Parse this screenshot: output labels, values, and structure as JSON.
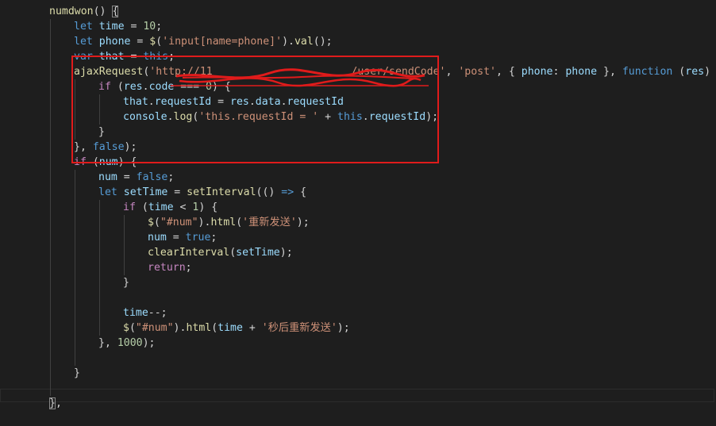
{
  "editor": {
    "theme": "dark",
    "background": "#1e1e1e",
    "annotation": {
      "color": "#e01b1b",
      "description": "red box around the request block; URL scribbled out in red"
    },
    "lines": [
      {
        "indent": 1,
        "tokens": [
          {
            "t": "numdwon",
            "c": "fn"
          },
          {
            "t": "() ",
            "c": "op"
          },
          {
            "t": "{",
            "c": "op",
            "box": true
          }
        ]
      },
      {
        "indent": 2,
        "tokens": [
          {
            "t": "let ",
            "c": "kw"
          },
          {
            "t": "time",
            "c": "var"
          },
          {
            "t": " = ",
            "c": "op"
          },
          {
            "t": "10",
            "c": "num"
          },
          {
            "t": ";",
            "c": "op"
          }
        ]
      },
      {
        "indent": 2,
        "tokens": [
          {
            "t": "let ",
            "c": "kw"
          },
          {
            "t": "phone",
            "c": "var"
          },
          {
            "t": " = ",
            "c": "op"
          },
          {
            "t": "$",
            "c": "fn"
          },
          {
            "t": "(",
            "c": "op"
          },
          {
            "t": "'input[name=phone]'",
            "c": "str"
          },
          {
            "t": ").",
            "c": "op"
          },
          {
            "t": "val",
            "c": "fn"
          },
          {
            "t": "();",
            "c": "op"
          }
        ]
      },
      {
        "indent": 2,
        "tokens": [
          {
            "t": "var ",
            "c": "kw"
          },
          {
            "t": "that",
            "c": "var"
          },
          {
            "t": " = ",
            "c": "op"
          },
          {
            "t": "this",
            "c": "kw"
          },
          {
            "t": ";",
            "c": "op"
          }
        ]
      },
      {
        "indent": 2,
        "redacted": true,
        "tokens": [
          {
            "t": "ajaxRequest",
            "c": "fn"
          },
          {
            "t": "(",
            "c": "op"
          },
          {
            "t": "'http://11",
            "c": "str"
          },
          {
            "t": "                      /user/sendCode'",
            "c": "str"
          },
          {
            "t": ", ",
            "c": "op"
          },
          {
            "t": "'post'",
            "c": "str"
          },
          {
            "t": ", { ",
            "c": "op"
          },
          {
            "t": "phone",
            "c": "var"
          },
          {
            "t": ": ",
            "c": "op"
          },
          {
            "t": "phone",
            "c": "var"
          },
          {
            "t": " }, ",
            "c": "op"
          },
          {
            "t": "function",
            "c": "kw"
          },
          {
            "t": " (",
            "c": "op"
          },
          {
            "t": "res",
            "c": "var"
          },
          {
            "t": ") {",
            "c": "op"
          }
        ]
      },
      {
        "indent": 3,
        "tokens": [
          {
            "t": "if",
            "c": "ctl"
          },
          {
            "t": " (",
            "c": "op"
          },
          {
            "t": "res",
            "c": "var"
          },
          {
            "t": ".",
            "c": "op"
          },
          {
            "t": "code",
            "c": "var"
          },
          {
            "t": " === ",
            "c": "op"
          },
          {
            "t": "0",
            "c": "num"
          },
          {
            "t": ") {",
            "c": "op"
          }
        ]
      },
      {
        "indent": 4,
        "tokens": [
          {
            "t": "that",
            "c": "var"
          },
          {
            "t": ".",
            "c": "op"
          },
          {
            "t": "requestId",
            "c": "var"
          },
          {
            "t": " = ",
            "c": "op"
          },
          {
            "t": "res",
            "c": "var"
          },
          {
            "t": ".",
            "c": "op"
          },
          {
            "t": "data",
            "c": "var"
          },
          {
            "t": ".",
            "c": "op"
          },
          {
            "t": "requestId",
            "c": "var"
          }
        ]
      },
      {
        "indent": 4,
        "tokens": [
          {
            "t": "console",
            "c": "var"
          },
          {
            "t": ".",
            "c": "op"
          },
          {
            "t": "log",
            "c": "fn"
          },
          {
            "t": "(",
            "c": "op"
          },
          {
            "t": "'this.requestId = '",
            "c": "str"
          },
          {
            "t": " + ",
            "c": "op"
          },
          {
            "t": "this",
            "c": "kw"
          },
          {
            "t": ".",
            "c": "op"
          },
          {
            "t": "requestId",
            "c": "var"
          },
          {
            "t": ");",
            "c": "op"
          }
        ]
      },
      {
        "indent": 3,
        "tokens": [
          {
            "t": "}",
            "c": "op"
          }
        ]
      },
      {
        "indent": 2,
        "tokens": [
          {
            "t": "}, ",
            "c": "op"
          },
          {
            "t": "false",
            "c": "kw"
          },
          {
            "t": ");",
            "c": "op"
          }
        ]
      },
      {
        "indent": 2,
        "tokens": [
          {
            "t": "if",
            "c": "ctl"
          },
          {
            "t": " (",
            "c": "op"
          },
          {
            "t": "num",
            "c": "var"
          },
          {
            "t": ") {",
            "c": "op"
          }
        ]
      },
      {
        "indent": 3,
        "tokens": [
          {
            "t": "num",
            "c": "var"
          },
          {
            "t": " = ",
            "c": "op"
          },
          {
            "t": "false",
            "c": "kw"
          },
          {
            "t": ";",
            "c": "op"
          }
        ]
      },
      {
        "indent": 3,
        "tokens": [
          {
            "t": "let ",
            "c": "kw"
          },
          {
            "t": "setTime",
            "c": "var"
          },
          {
            "t": " = ",
            "c": "op"
          },
          {
            "t": "setInterval",
            "c": "fn"
          },
          {
            "t": "(() ",
            "c": "op"
          },
          {
            "t": "=>",
            "c": "kw"
          },
          {
            "t": " {",
            "c": "op"
          }
        ]
      },
      {
        "indent": 4,
        "tokens": [
          {
            "t": "if",
            "c": "ctl"
          },
          {
            "t": " (",
            "c": "op"
          },
          {
            "t": "time",
            "c": "var"
          },
          {
            "t": " < ",
            "c": "op"
          },
          {
            "t": "1",
            "c": "num"
          },
          {
            "t": ") {",
            "c": "op"
          }
        ]
      },
      {
        "indent": 5,
        "tokens": [
          {
            "t": "$",
            "c": "fn"
          },
          {
            "t": "(",
            "c": "op"
          },
          {
            "t": "\"#num\"",
            "c": "str"
          },
          {
            "t": ").",
            "c": "op"
          },
          {
            "t": "html",
            "c": "fn"
          },
          {
            "t": "(",
            "c": "op"
          },
          {
            "t": "'重新发送'",
            "c": "str"
          },
          {
            "t": ");",
            "c": "op"
          }
        ]
      },
      {
        "indent": 5,
        "tokens": [
          {
            "t": "num",
            "c": "var"
          },
          {
            "t": " = ",
            "c": "op"
          },
          {
            "t": "true",
            "c": "kw"
          },
          {
            "t": ";",
            "c": "op"
          }
        ]
      },
      {
        "indent": 5,
        "tokens": [
          {
            "t": "clearInterval",
            "c": "fn"
          },
          {
            "t": "(",
            "c": "op"
          },
          {
            "t": "setTime",
            "c": "var"
          },
          {
            "t": ");",
            "c": "op"
          }
        ]
      },
      {
        "indent": 5,
        "tokens": [
          {
            "t": "return",
            "c": "ctl"
          },
          {
            "t": ";",
            "c": "op"
          }
        ]
      },
      {
        "indent": 4,
        "tokens": [
          {
            "t": "}",
            "c": "op"
          }
        ]
      },
      {
        "indent": 4,
        "tokens": []
      },
      {
        "indent": 4,
        "tokens": [
          {
            "t": "time",
            "c": "var"
          },
          {
            "t": "--;",
            "c": "op"
          }
        ]
      },
      {
        "indent": 4,
        "tokens": [
          {
            "t": "$",
            "c": "fn"
          },
          {
            "t": "(",
            "c": "op"
          },
          {
            "t": "\"#num\"",
            "c": "str"
          },
          {
            "t": ").",
            "c": "op"
          },
          {
            "t": "html",
            "c": "fn"
          },
          {
            "t": "(",
            "c": "op"
          },
          {
            "t": "time",
            "c": "var"
          },
          {
            "t": " + ",
            "c": "op"
          },
          {
            "t": "'秒后重新发送'",
            "c": "str"
          },
          {
            "t": ");",
            "c": "op"
          }
        ]
      },
      {
        "indent": 3,
        "tokens": [
          {
            "t": "}, ",
            "c": "op"
          },
          {
            "t": "1000",
            "c": "num"
          },
          {
            "t": ");",
            "c": "op"
          }
        ]
      },
      {
        "indent": 3,
        "tokens": []
      },
      {
        "indent": 2,
        "tokens": [
          {
            "t": "}",
            "c": "op"
          }
        ]
      },
      {
        "indent": 2,
        "current": true,
        "tokens": []
      },
      {
        "indent": 1,
        "tokens": [
          {
            "t": "}",
            "c": "op",
            "box": true
          },
          {
            "t": ",",
            "c": "op"
          }
        ]
      },
      {
        "indent": 1,
        "tokens": [
          {
            "t": "",
            "c": "op"
          }
        ]
      }
    ]
  }
}
